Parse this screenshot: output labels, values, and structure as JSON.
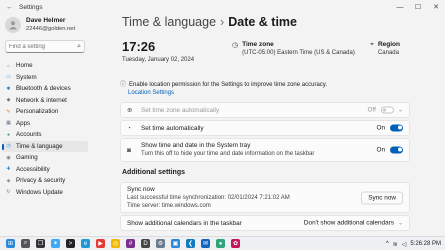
{
  "window": {
    "title": "Settings",
    "back": "←",
    "controls": {
      "minimize": "—",
      "maximize": "☐",
      "close": "✕"
    }
  },
  "profile": {
    "name": "Dave Helmer",
    "email": "22446@golden.net"
  },
  "search": {
    "placeholder": "Find a setting",
    "icon": "search-icon"
  },
  "nav": [
    {
      "label": "Home",
      "icon": "home-icon",
      "color": "#e07b39",
      "glyph": "⌂"
    },
    {
      "label": "System",
      "icon": "monitor-icon",
      "color": "#2b88d8",
      "glyph": "▭"
    },
    {
      "label": "Bluetooth & devices",
      "icon": "bluetooth-icon",
      "color": "#2b88d8",
      "glyph": "✱"
    },
    {
      "label": "Network & internet",
      "icon": "wifi-icon",
      "color": "#6b7b8c",
      "glyph": "◆"
    },
    {
      "label": "Personalization",
      "icon": "brush-icon",
      "color": "#d4883a",
      "glyph": "✎"
    },
    {
      "label": "Apps",
      "icon": "apps-icon",
      "color": "#5a6b7c",
      "glyph": "▦"
    },
    {
      "label": "Accounts",
      "icon": "person-icon",
      "color": "#2fa37a",
      "glyph": "●"
    },
    {
      "label": "Time & language",
      "icon": "globe-clock-icon",
      "color": "#2b88d8",
      "glyph": "◷"
    },
    {
      "label": "Gaming",
      "icon": "controller-icon",
      "color": "#6b7b8c",
      "glyph": "◉"
    },
    {
      "label": "Accessibility",
      "icon": "accessibility-icon",
      "color": "#2b88d8",
      "glyph": "✚"
    },
    {
      "label": "Privacy & security",
      "icon": "shield-icon",
      "color": "#6b7b8c",
      "glyph": "◈"
    },
    {
      "label": "Windows Update",
      "icon": "update-icon",
      "color": "#2b88d8",
      "glyph": "↻"
    }
  ],
  "active_nav_index": 7,
  "header": {
    "parent": "Time & language",
    "separator": "›",
    "current": "Date & time"
  },
  "clock": {
    "time": "17:26",
    "date": "Tuesday, January 02, 2024"
  },
  "time_zone": {
    "label": "Time zone",
    "value": "(UTC-05:00) Eastern Time (US & Canada)",
    "icon": "clock-icon"
  },
  "region": {
    "label": "Region",
    "value": "Canada",
    "icon": "location-icon"
  },
  "notice": {
    "text": "Enable location permission for the Settings to improve time zone accuracy.",
    "link": "Location Settings",
    "icon": "info-icon"
  },
  "settings": {
    "tz_auto": {
      "label": "Set time zone automatically",
      "state": "Off",
      "enabled": false
    },
    "time_auto": {
      "label": "Set time automatically",
      "state": "On"
    },
    "tray": {
      "label": "Show time and date in the System tray",
      "sub": "Turn this off to hide your time and date information on the taskbar",
      "state": "On"
    }
  },
  "additional": {
    "title": "Additional settings",
    "sync": {
      "title": "Sync now",
      "last": "Last successful time synchronization: 02/01/2024 7:21:02 AM",
      "server": "Time server: time.windows.com",
      "button": "Sync now"
    },
    "calendars": {
      "label": "Show additional calendars in the taskbar",
      "value": "Don't show additional calendars"
    }
  },
  "taskbar": {
    "icons": [
      {
        "name": "start-icon",
        "color": "#2b88d8",
        "glyph": "⊞"
      },
      {
        "name": "search-taskbar-icon",
        "color": "#555555",
        "glyph": "⌕"
      },
      {
        "name": "task-view-icon",
        "color": "#333333",
        "glyph": "❐"
      },
      {
        "name": "copilot-icon",
        "color": "#3fa9f5",
        "glyph": "✦"
      },
      {
        "name": "terminal-icon",
        "color": "#222222",
        "glyph": ">"
      },
      {
        "name": "edge-icon",
        "color": "#1c9ad6",
        "glyph": "e"
      },
      {
        "name": "youtube-icon",
        "color": "#e53935",
        "glyph": "▶"
      },
      {
        "name": "chrome-icon",
        "color": "#f2b705",
        "glyph": "◎"
      },
      {
        "name": "slack-icon",
        "color": "#7a2f8f",
        "glyph": "#"
      },
      {
        "name": "dev-icon",
        "color": "#444444",
        "glyph": "D"
      },
      {
        "name": "settings-app-icon",
        "color": "#6b7b8c",
        "glyph": "⚙"
      },
      {
        "name": "store-icon",
        "color": "#2b88d8",
        "glyph": "▣"
      },
      {
        "name": "vscode-icon",
        "color": "#0e7ac0",
        "glyph": "❮"
      },
      {
        "name": "mail-icon",
        "color": "#1565c0",
        "glyph": "✉"
      },
      {
        "name": "pinned-icon",
        "color": "#2fa37a",
        "glyph": "●"
      },
      {
        "name": "photos-icon",
        "color": "#c2185b",
        "glyph": "✿"
      }
    ],
    "tray": {
      "chevron": "^",
      "time": "5:26:28 PM"
    }
  },
  "colors": {
    "accent": "#005fb8",
    "window_bg": "#f3f3f3",
    "card_bg": "#fbfbfb"
  }
}
